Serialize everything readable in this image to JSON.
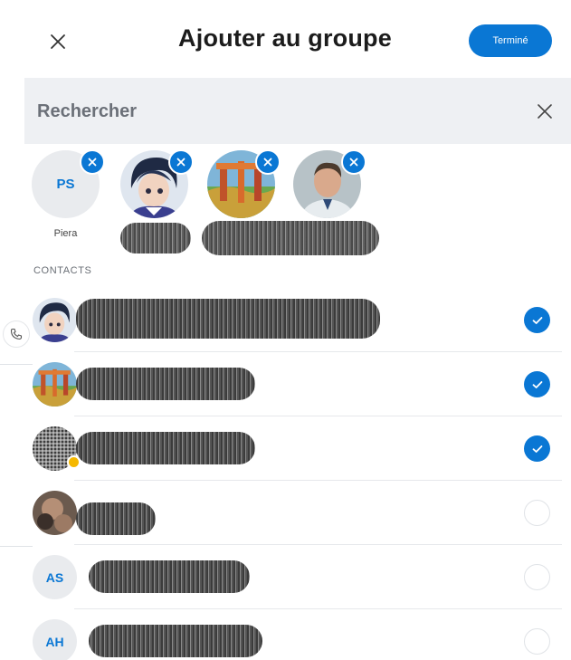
{
  "header": {
    "title": "Ajouter au groupe",
    "done_label": "Terminé"
  },
  "search": {
    "placeholder": "Rechercher"
  },
  "selected": [
    {
      "initials": "PS",
      "label": "Piera"
    },
    {
      "initials": "",
      "label": ""
    },
    {
      "initials": "",
      "label": ""
    },
    {
      "initials": "",
      "label": ""
    }
  ],
  "section": {
    "contacts_label": "CONTACTS"
  },
  "contacts": [
    {
      "initials": "",
      "name": "",
      "selected": true
    },
    {
      "initials": "",
      "name": "",
      "selected": true
    },
    {
      "initials": "",
      "name": "",
      "selected": true
    },
    {
      "initials": "",
      "name": "",
      "selected": false
    },
    {
      "initials": "AS",
      "name": "",
      "selected": false
    },
    {
      "initials": "AH",
      "name": "",
      "selected": false
    }
  ],
  "colors": {
    "accent": "#0a77d4",
    "search_bg": "#eef0f3"
  }
}
